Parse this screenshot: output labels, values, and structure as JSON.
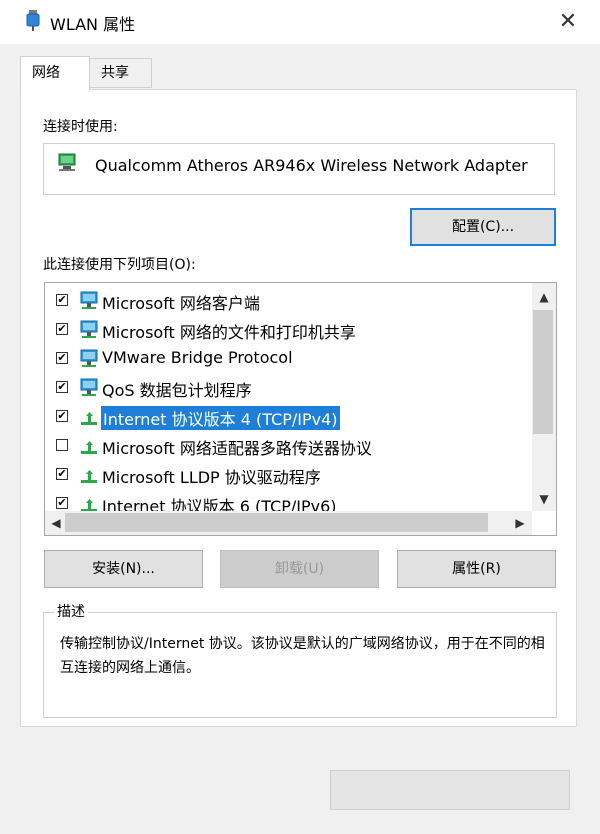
{
  "window": {
    "title": "WLAN 属性",
    "close_label": "✕"
  },
  "tabs": [
    {
      "label": "网络"
    },
    {
      "label": "共享"
    }
  ],
  "connect_using": {
    "label": "连接时使用:",
    "adapter_name": "Qualcomm Atheros AR946x Wireless Network Adapter",
    "configure_button": "配置(C)..."
  },
  "items": {
    "label": "此连接使用下列项目(O):",
    "list": [
      {
        "label": "Microsoft 网络客户端",
        "checked": true,
        "icon": "network-client-icon"
      },
      {
        "label": "Microsoft 网络的文件和打印机共享",
        "checked": true,
        "icon": "network-client-icon"
      },
      {
        "label": "VMware Bridge Protocol",
        "checked": true,
        "icon": "network-client-icon"
      },
      {
        "label": "QoS 数据包计划程序",
        "checked": true,
        "icon": "network-client-icon"
      },
      {
        "label": "Internet 协议版本 4 (TCP/IPv4)",
        "checked": true,
        "icon": "protocol-icon",
        "selected": true
      },
      {
        "label": "Microsoft 网络适配器多路传送器协议",
        "checked": false,
        "icon": "protocol-icon"
      },
      {
        "label": "Microsoft LLDP 协议驱动程序",
        "checked": true,
        "icon": "protocol-icon"
      },
      {
        "label": "Internet 协议版本 6 (TCP/IPv6)",
        "checked": true,
        "icon": "protocol-icon"
      }
    ]
  },
  "buttons": {
    "install": "安装(N)...",
    "uninstall": "卸载(U)",
    "properties": "属性(R)"
  },
  "description": {
    "title": "描述",
    "text": "传输控制协议/Internet 协议。该协议是默认的广域网络协议，用于在不同的相互连接的网络上通信。"
  },
  "colors": {
    "accent": "#1e7fd8",
    "selection": "#1e7fd8"
  }
}
